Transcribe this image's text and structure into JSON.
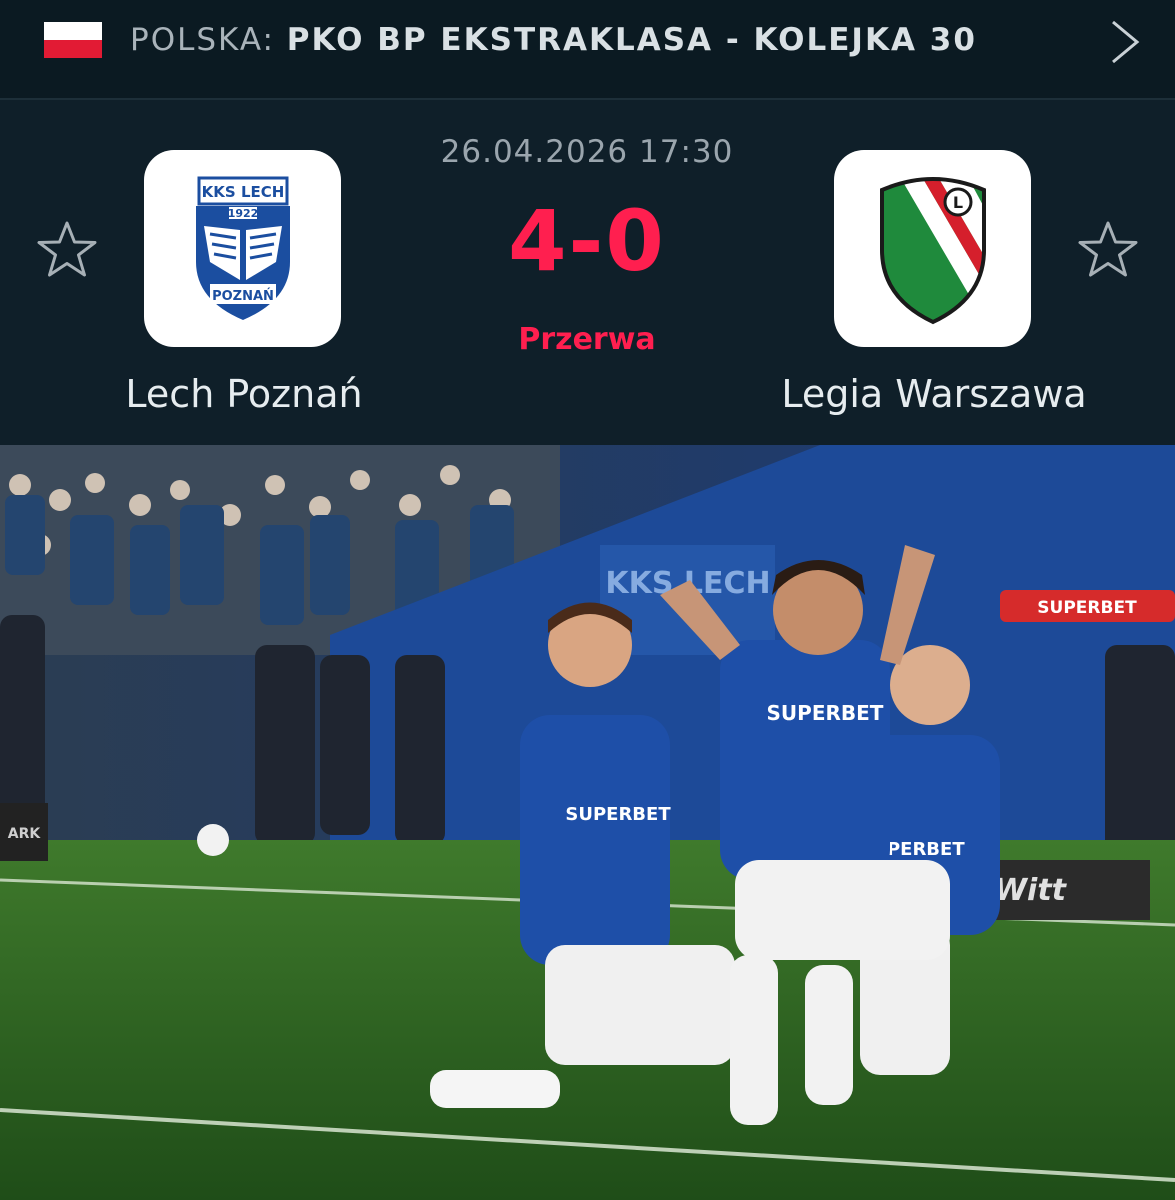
{
  "header": {
    "country": "POLSKA:",
    "league": "PKO BP EKSTRAKLASA - KOLEJKA 30",
    "flag_colors": [
      "#ffffff",
      "#e21b34"
    ],
    "chevron_icon": "chevron-right-icon"
  },
  "match": {
    "datetime": "26.04.2026 17:30",
    "score": "4-0",
    "status": "Przerwa",
    "accent_color": "#ff1f4f",
    "home": {
      "name": "Lech Poznań",
      "crest_top": "KKS LECH",
      "crest_year": "1922",
      "crest_bottom": "POZNAŃ",
      "favorite_icon": "star-outline-icon"
    },
    "away": {
      "name": "Legia Warszawa",
      "crest_letter": "L",
      "favorite_icon": "star-outline-icon"
    }
  },
  "photo": {
    "board_brand": "SUPERBET",
    "jersey_sponsor": "SUPERBET",
    "stand_sign": "KKS LECH",
    "pitch_ad": "Witt",
    "left_ad": "ARK"
  }
}
